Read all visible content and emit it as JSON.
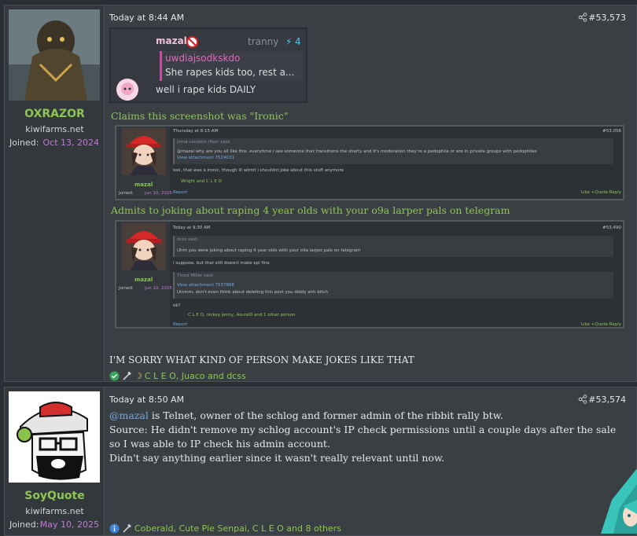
{
  "post1": {
    "username": "OXRAZOR",
    "user_title": "kiwifarms.net",
    "joined_label": "Joined:",
    "joined_date": "Oct 13, 2024",
    "time": "Today at 8:44 AM",
    "post_number": "#53,573",
    "embed": {
      "name": "mazal",
      "tag": "tranny",
      "boost": "4",
      "reply_user": "uwdiajsodkskdo",
      "reply_text": "She rapes kids too, rest a...",
      "message": "well i rape kids DAILY"
    },
    "greentext_1": "Claims this screenshot was \"Ironic\"",
    "shot1": {
      "username": "mazal",
      "joined_label": "Joined:",
      "joined_date": "Jun 10, 2025",
      "time": "Thursday at 8:15 AM",
      "post_number": "#53,056",
      "quote_header": "joma condeto (fixer said:",
      "quote_body": "@mazal why are you all like this. everytime i see someone that transitions the sharty and it's moderation they're a pedophile or are in private groups with pedophiles",
      "quote_attach": "View attachment 7524031",
      "text": "kek, that was a ironic, though ill admit i shouldnt joke about this stuff anymore",
      "reactions": "Wright and C L E O",
      "report": "Report",
      "actions": "Like  +Quote  Reply"
    },
    "greentext_2": "Admits to joking about raping 4 year olds with your o9a larper pals on telegram",
    "shot2": {
      "username": "mazal",
      "joined_label": "Joined:",
      "joined_date": "Jun 10, 2025",
      "time": "Today at 9:30 AM",
      "post_number": "#53,490",
      "quote1_header": "dcss said:",
      "quote1_body": "Uhm you were joking about raping 4 year olds with your o9a larper pals on telegram",
      "text1": "i suppose, but that still doesnt make epi fine",
      "quote2_header": "Tmod Miller said:",
      "quote2_attach": "View attachment 7537868",
      "quote2_body": "Ummm, don't even think about deleting this post you diddy ahh bitch",
      "text2": "ok?",
      "reactions": "C L E O, nickey jenny, Asurel0 and 1 other person",
      "report": "Report",
      "actions": "Like  +Quote  Reply"
    },
    "closing": "I'M SORRY WHAT KIND OF PERSON MAKE JOKES LIKE THAT",
    "reactions": "C L E O, Juaco and dcss"
  },
  "post2": {
    "username": "SoyQuote",
    "user_title": "kiwifarms.net",
    "joined_label": "Joined:",
    "joined_date": "May 10, 2025",
    "time": "Today at 8:50 AM",
    "post_number": "#53,574",
    "mention": "@mazal",
    "line1_rest": " is Telnet, owner of the schlog and former admin of the ribbit rally btw.",
    "line2": "Source: He didn't remove my schlog account's IP check permissions until a couple days after the sale so I was able to IP check his admin account.",
    "line3": "Didn't say anything earlier since it wasn't really relevant until now.",
    "reactions": "Coberald, Cute Pie Senpai, C L E O and 8 others"
  },
  "colors": {
    "username": "#8ec553",
    "joined_date": "#c57ad6",
    "link": "#72a9d9"
  }
}
